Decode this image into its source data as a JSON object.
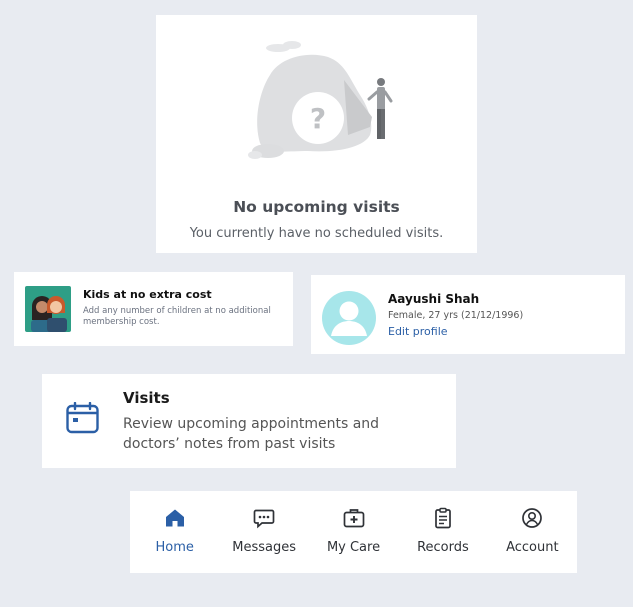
{
  "empty_state": {
    "title": "No upcoming visits",
    "subtitle": "You currently have no scheduled visits.",
    "illustration_icon": "question-mark-illustration"
  },
  "kids_promo": {
    "title": "Kids at no extra cost",
    "description": "Add any number of children at no additional membership cost.",
    "image_icon": "kids-illustration"
  },
  "profile": {
    "name": "Aayushi Shah",
    "details": "Female, 27 yrs (21/12/1996)",
    "edit_label": "Edit profile",
    "avatar_icon": "user-avatar-icon",
    "avatar_color": "#a7e6ea"
  },
  "visits_feature": {
    "title": "Visits",
    "description": "Review upcoming appointments and doctors’ notes from past visits",
    "icon": "calendar-icon"
  },
  "bottom_nav": {
    "active": "home",
    "accent_color": "#2b5fa6",
    "items": [
      {
        "label": "Home",
        "icon": "home-icon"
      },
      {
        "label": "Messages",
        "icon": "messages-icon"
      },
      {
        "label": "My Care",
        "icon": "medical-kit-icon"
      },
      {
        "label": "Records",
        "icon": "clipboard-icon"
      },
      {
        "label": "Account",
        "icon": "account-icon"
      }
    ]
  }
}
